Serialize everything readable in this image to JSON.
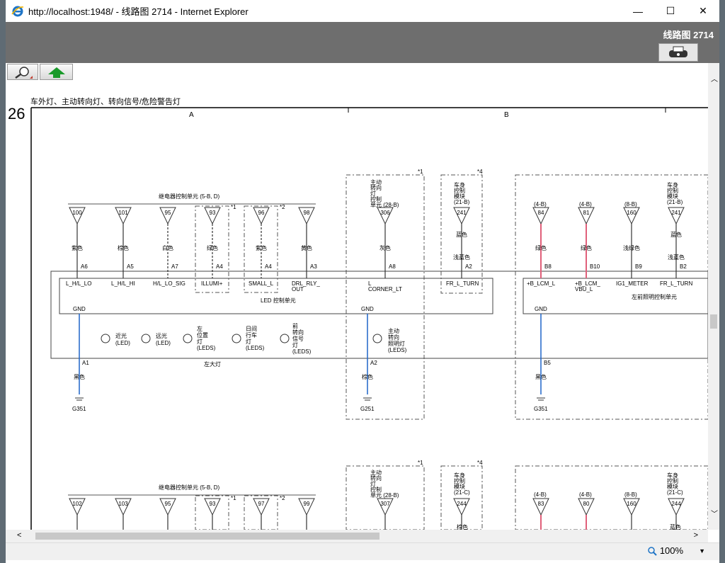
{
  "window": {
    "title": "http://localhost:1948/ - 线路图 2714 - Internet Explorer",
    "minimize": "—",
    "maximize": "☐",
    "close": "✕"
  },
  "header": {
    "title": "线路图 2714"
  },
  "status": {
    "zoom": "100%"
  },
  "diagram": {
    "caption": "车外灯、主动转向灯、转向信号/危险警告灯",
    "page_number": "26",
    "zones": [
      "A",
      "B"
    ],
    "relay_unit_label": "继电器控制单元 (5-B, D)",
    "relay_unit_label_2": "继电器控制单元 (5-B, D)",
    "pins_top": [
      "100",
      "101",
      "95",
      "93",
      "96",
      "98",
      "306",
      "241",
      "84",
      "81",
      "160",
      "241"
    ],
    "pins_bottom": [
      "102",
      "103",
      "95",
      "93",
      "97",
      "99",
      "307",
      "244",
      "83",
      "80",
      "160",
      "244"
    ],
    "wire_colors": [
      "紫色",
      "棕色",
      "白色",
      "绿色",
      "紫色",
      "黄色",
      "灰色",
      "蓝色",
      "浅蓝色",
      "绿色",
      "绿色",
      "浅绿色",
      "浅蓝色",
      "蓝色"
    ],
    "connectors": [
      "A6",
      "A5",
      "A7",
      "A4",
      "A4",
      "A3",
      "A8",
      "A2",
      "B8",
      "B10",
      "B9",
      "B2"
    ],
    "signals": [
      "L_H/L_LO",
      "L_H/L_HI",
      "H/L_LO_SIG",
      "ILLUMI+",
      "SMALL_L",
      "DRL_RLY_",
      "OUT",
      "L",
      "CORNER_LT",
      "FR_L_TURN",
      "+B_LCM_L",
      "+B_LCM_",
      "VBU_L",
      "IG1_METER",
      "FR_L_TURN"
    ],
    "led_unit": "LED 控制单元",
    "left_headlamp": "左大灯",
    "right_unit": "左前照明控制单元",
    "gnd": "GND",
    "lamps": [
      "近光",
      "(LED)",
      "远光",
      "(LED)",
      "左",
      "位置",
      "灯",
      "(LEDS)",
      "日间",
      "行车",
      "灯",
      "(LEDS)",
      "前",
      "转向",
      "信号",
      "灯",
      "(LEDS)"
    ],
    "active_lamp": [
      "主动",
      "转向",
      "照明灯",
      "(LEDS)"
    ],
    "ground_points": [
      "A1",
      "黑色",
      "G351",
      "A2",
      "棕色",
      "G251",
      "B5",
      "黑色",
      "G351"
    ],
    "active_unit": [
      "主动",
      "转向",
      "灯",
      "控制",
      "单元 (28-B)"
    ],
    "active_unit_2": [
      "主动",
      "转向",
      "灯",
      "控制",
      "单元 (28-B)"
    ],
    "body_module": [
      "车身",
      "控制",
      "模块",
      "(21-B)"
    ],
    "body_module_c": [
      "车身",
      "控制",
      "模块",
      "(21-C)"
    ],
    "refs": [
      "(4-B)",
      "(4-B)",
      "(8-B)"
    ],
    "notes": [
      "*1",
      "*2",
      "*1",
      "*4"
    ],
    "brown_label": "棕色",
    "blue_label": "蓝色"
  }
}
